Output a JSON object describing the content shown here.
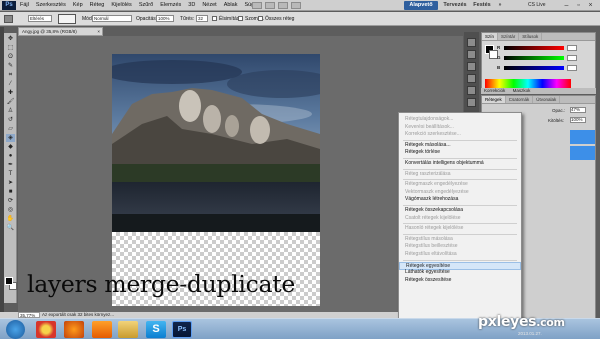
{
  "menubar": {
    "logo": "Ps",
    "menus": [
      "Fájl",
      "Szerkesztés",
      "Kép",
      "Réteg",
      "Kijelölés",
      "Szűrő",
      "Elemzés",
      "3D",
      "Nézet",
      "Ablak",
      "Súgó"
    ],
    "workspaces": {
      "active": "Alapvető",
      "design": "Tervezés",
      "paint": "Festés"
    },
    "cslive": "CS Live"
  },
  "options": {
    "feather_label": "Eltérés",
    "feather_value": "Eltérés",
    "mode_label": "Mód:",
    "mode_value": "Normál",
    "opacity_label": "Opacitás:",
    "opacity_value": "100%",
    "tolerance_label": "Tűrés:",
    "tolerance_value": "32",
    "antialias": "Élsimítás",
    "contiguous": "Szomsz.",
    "all_layers": "Összes réteg"
  },
  "document": {
    "tab_title": "Angy.jpg @ 35,8% (RGB/8)",
    "zoom": "35,77%",
    "status": "Az exportált csak 32 bites környez..."
  },
  "caption": "layers merge-duplicate",
  "panels": {
    "color_tabs": [
      "Szín",
      "Színtár",
      "Stílusok"
    ],
    "color_labels": {
      "r": "R",
      "g": "G",
      "b": "B"
    },
    "color_values": {
      "r": "",
      "g": "",
      "b": ""
    },
    "adj_tabs": [
      "Korrekciók",
      "Maszkok"
    ],
    "layer_tabs": [
      "Rétegek",
      "Csatornák",
      "Útvonalak"
    ],
    "opacity_label": "Opac.:",
    "opacity_value": "47%",
    "fill_label": "Kitöltés:",
    "fill_value": "100%"
  },
  "context_menu": {
    "items": [
      {
        "label": "Rétegtulajdonságok...",
        "state": "dis"
      },
      {
        "label": "Keverési beállítások...",
        "state": "dis"
      },
      {
        "label": "Korrekció szerkesztése...",
        "state": "dis"
      },
      {
        "sep": true
      },
      {
        "label": "Rétegek másolása...",
        "state": "en"
      },
      {
        "label": "Rétegek törlése",
        "state": "en"
      },
      {
        "sep": true
      },
      {
        "label": "Konvertálás intelligens objektummá",
        "state": "en"
      },
      {
        "sep": true
      },
      {
        "label": "Réteg raszterizálása",
        "state": "dis"
      },
      {
        "sep": true
      },
      {
        "label": "Rétegmaszk engedélyezése",
        "state": "dis"
      },
      {
        "label": "Vektormaszk engedélyezése",
        "state": "dis"
      },
      {
        "label": "Vágómaszk létrehozása",
        "state": "en"
      },
      {
        "sep": true
      },
      {
        "label": "Rétegek összekapcsolása",
        "state": "en"
      },
      {
        "label": "Csatolt rétegek kijelölése",
        "state": "dis"
      },
      {
        "sep": true
      },
      {
        "label": "Hasonló rétegek kijelölése",
        "state": "dis"
      },
      {
        "sep": true
      },
      {
        "label": "Rétegstílus másolása",
        "state": "dis"
      },
      {
        "label": "Rétegstílus beillesztése",
        "state": "dis"
      },
      {
        "label": "Rétegstílus eltávolítása",
        "state": "dis"
      },
      {
        "sep": true
      },
      {
        "label": "Rétegek egyesítése",
        "state": "hi"
      },
      {
        "label": "Láthatók egyesítése",
        "state": "en"
      },
      {
        "label": "Rétegek összesítése",
        "state": "en"
      }
    ]
  },
  "watermark": {
    "main": "pxleyes",
    "suffix": ".com"
  },
  "clock": "2013.01.27."
}
